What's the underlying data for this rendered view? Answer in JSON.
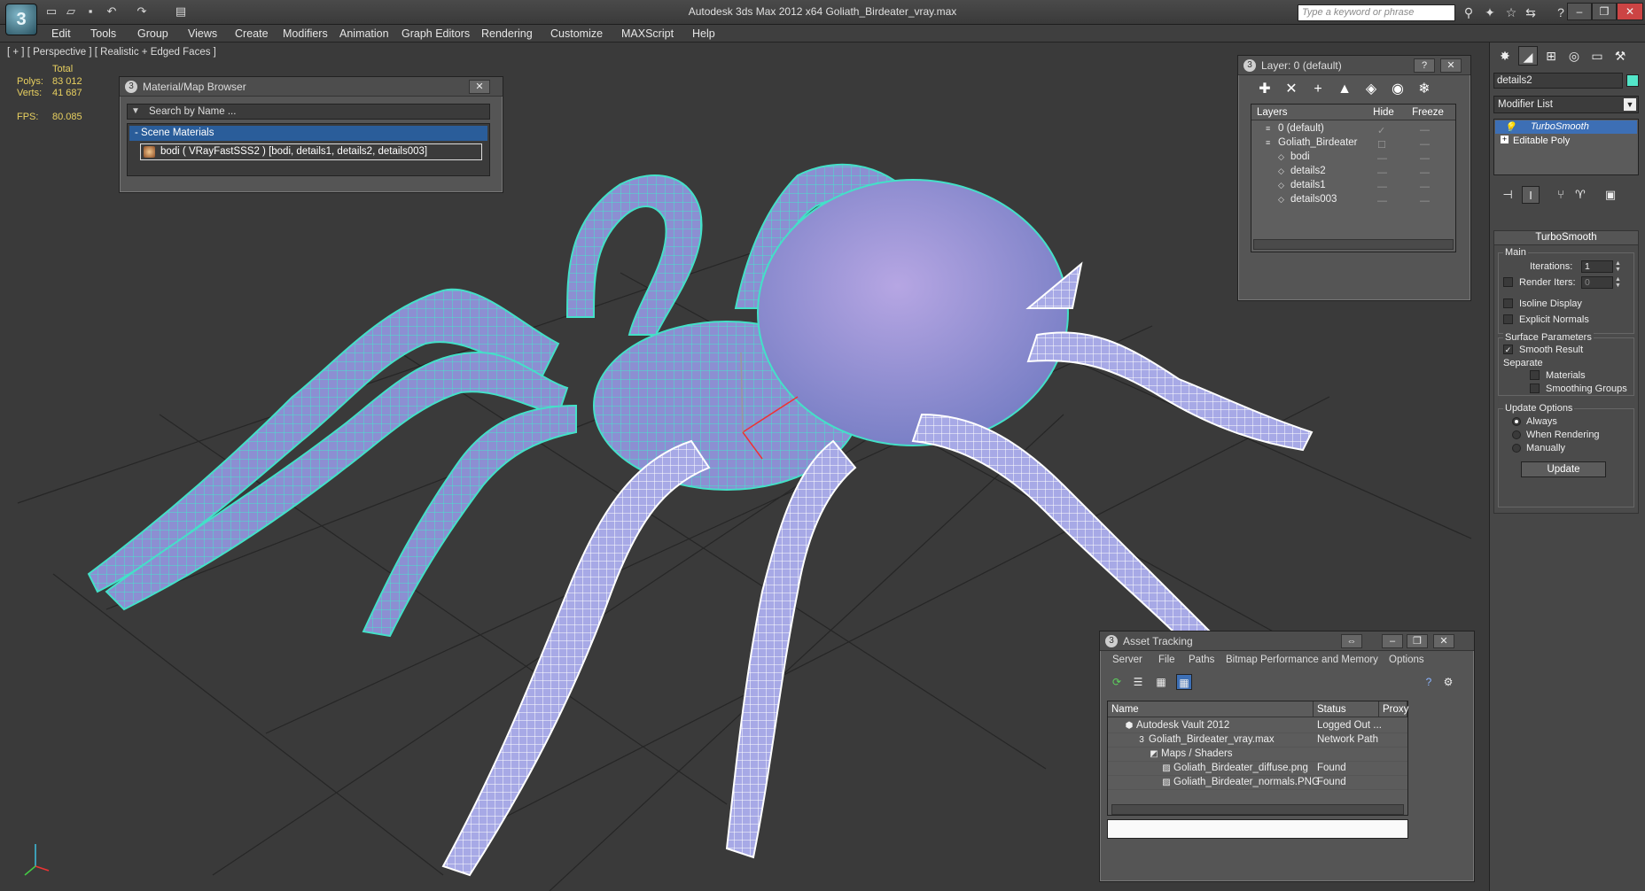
{
  "app": {
    "logo": "3ds-max-logo",
    "title": "Autodesk 3ds Max  2012 x64      Goliath_Birdeater_vray.max",
    "search_placeholder": "Type a keyword or phrase"
  },
  "quick_access": [
    "new-file-icon",
    "open-file-icon",
    "save-icon",
    "undo-icon",
    "redo-icon",
    "project-folder-icon"
  ],
  "menu": [
    "Edit",
    "Tools",
    "Group",
    "Views",
    "Create",
    "Modifiers",
    "Animation",
    "Graph Editors",
    "Rendering",
    "Customize",
    "MAXScript",
    "Help"
  ],
  "viewport": {
    "label": "[ + ] [ Perspective ] [ Realistic + Edged Faces ]",
    "stats": {
      "total_label": "Total",
      "polys_label": "Polys:",
      "polys_value": "83 012",
      "verts_label": "Verts:",
      "verts_value": "41 687",
      "fps_label": "FPS:",
      "fps_value": "80.085"
    }
  },
  "material_browser": {
    "title": "Material/Map Browser",
    "search_placeholder": "Search by Name ...",
    "group_label": "- Scene Materials",
    "material_entry": "bodi  ( VRayFastSSS2 ) [bodi, details1, details2, details003]"
  },
  "layer_panel": {
    "title": "Layer: 0 (default)",
    "columns": {
      "name": "Layers",
      "hide": "Hide",
      "freeze": "Freeze"
    },
    "rows": [
      {
        "label": "0 (default)",
        "indent": 0,
        "hide": "✓",
        "freeze": "—"
      },
      {
        "label": "Goliath_Birdeater",
        "indent": 0,
        "hide": "☐",
        "freeze": "—"
      },
      {
        "label": "bodi",
        "indent": 1,
        "hide": "—",
        "freeze": "—"
      },
      {
        "label": "details2",
        "indent": 1,
        "hide": "—",
        "freeze": "—"
      },
      {
        "label": "details1",
        "indent": 1,
        "hide": "—",
        "freeze": "—"
      },
      {
        "label": "details003",
        "indent": 1,
        "hide": "—",
        "freeze": "—"
      }
    ]
  },
  "command_panel": {
    "object_name": "details2",
    "object_color": "#53e6c9",
    "modifier_list_label": "Modifier List",
    "stack": {
      "selected": "TurboSmooth",
      "base": "Editable Poly"
    },
    "turbosmooth": {
      "title": "TurboSmooth",
      "main_label": "Main",
      "iterations_label": "Iterations:",
      "iterations_value": "1",
      "render_iters_label": "Render Iters:",
      "render_iters_value": "0",
      "isoline_label": "Isoline Display",
      "explicit_normals_label": "Explicit Normals",
      "surface_params_label": "Surface Parameters",
      "smooth_result_label": "Smooth Result",
      "separate_label": "Separate",
      "materials_label": "Materials",
      "smoothing_groups_label": "Smoothing Groups",
      "update_options_label": "Update Options",
      "always_label": "Always",
      "when_rendering_label": "When Rendering",
      "manually_label": "Manually",
      "update_button": "Update"
    }
  },
  "asset_tracking": {
    "title": "Asset Tracking",
    "menu": [
      "Server",
      "File",
      "Paths",
      "Bitmap Performance and Memory",
      "Options"
    ],
    "columns": {
      "name": "Name",
      "status": "Status",
      "proxy": "Proxy"
    },
    "rows": [
      {
        "name": "Autodesk Vault 2012",
        "status": "Logged Out ...",
        "indent": 1,
        "icon": "vault-icon"
      },
      {
        "name": "Goliath_Birdeater_vray.max",
        "status": "Network Path",
        "indent": 2,
        "icon": "max-file-icon"
      },
      {
        "name": "Maps / Shaders",
        "status": "",
        "indent": 3,
        "icon": "maps-icon"
      },
      {
        "name": "Goliath_Birdeater_diffuse.png",
        "status": "Found",
        "indent": 4,
        "icon": "image-file-icon"
      },
      {
        "name": "Goliath_Birdeater_normals.PNG",
        "status": "Found",
        "indent": 4,
        "icon": "image-file-icon"
      }
    ]
  },
  "colors": {
    "selection_wire": "#3fe0c8",
    "spider_body": "#8a8ed0",
    "wire_white": "#ffffff",
    "viewport_bg": "#3a3a3a",
    "selection_blue": "#3d6fb5"
  }
}
